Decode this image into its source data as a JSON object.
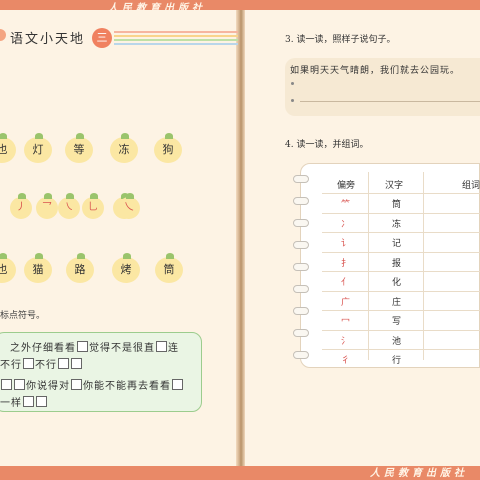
{
  "publisher": {
    "top": "人民教育出版社",
    "bottom": "人民教育出版社"
  },
  "left_page": {
    "title": "语文小天地",
    "badge": "三",
    "stripe_colors": [
      "#f6b59f",
      "#f9d48c",
      "#bfe0a6",
      "#b9d6ea"
    ],
    "row1_chars": [
      "也",
      "灯",
      "等",
      "冻",
      "狗"
    ],
    "row2_strokes": [
      "丿",
      "乛",
      "㇏",
      "乚",
      "丶",
      "乀"
    ],
    "row3_chars": [
      "也",
      "猫",
      "路",
      "烤",
      "筒"
    ],
    "punct_instruction": "标点符号。",
    "exercise_lines": [
      "之外仔细看看",
      "觉得不是很直",
      "连",
      "不行",
      "不行",
      "你说得对",
      "你能不能再去看看",
      "一样"
    ]
  },
  "right_page": {
    "q3_title": "3. 读一读，照样子说句子。",
    "q3_sentence": "如果明天天气晴朗，我们就去公园玩。",
    "q4_title": "4. 读一读，并组词。",
    "table_headers": [
      "偏旁",
      "汉字",
      "组词"
    ],
    "table_rows": [
      {
        "radical": "⺮",
        "char": "筒"
      },
      {
        "radical": "冫",
        "char": "冻"
      },
      {
        "radical": "讠",
        "char": "记"
      },
      {
        "radical": "扌",
        "char": "报"
      },
      {
        "radical": "亻",
        "char": "化"
      },
      {
        "radical": "广",
        "char": "庄"
      },
      {
        "radical": "冖",
        "char": "写"
      },
      {
        "radical": "氵",
        "char": "池"
      },
      {
        "radical": "彳",
        "char": "行"
      }
    ]
  },
  "colors": {
    "accent": "#e98967",
    "page": "#fdf3e4",
    "fruit": "#fbe7a3",
    "green_box": "#eaf5e4"
  }
}
